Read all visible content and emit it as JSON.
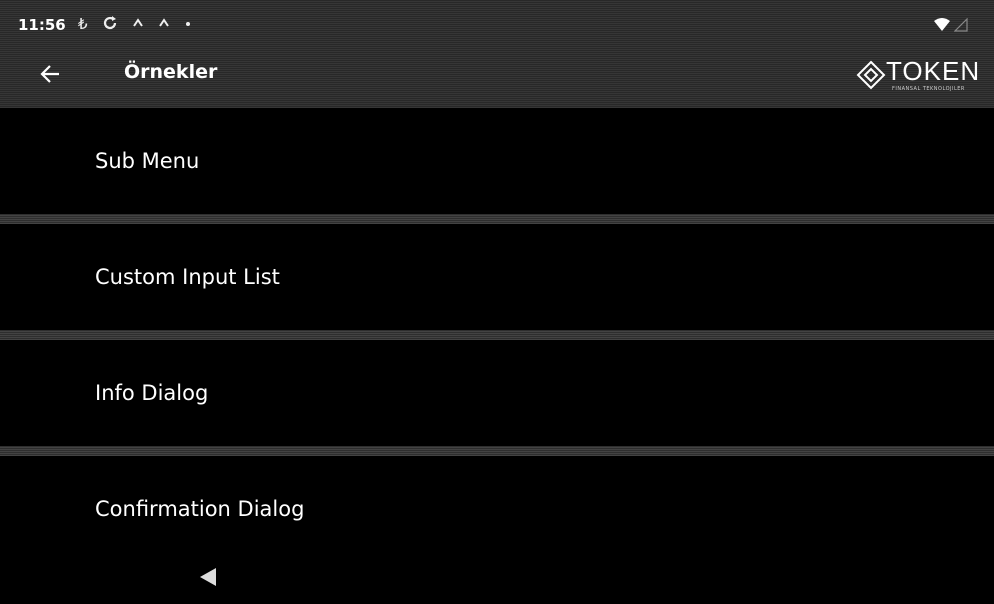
{
  "status_bar": {
    "time": "11:56",
    "icons": [
      "lira-icon",
      "sync-icon",
      "notification-icon",
      "notification-icon",
      "dot-icon"
    ],
    "right_icons": [
      "wifi-icon",
      "signal-icon"
    ]
  },
  "app_bar": {
    "title": "Örnekler",
    "logo_text": "TOKEN",
    "logo_subtitle": "FINANSAL TEKNOLOJILER"
  },
  "menu": {
    "items": [
      {
        "label": "Sub Menu"
      },
      {
        "label": "Custom Input List"
      },
      {
        "label": "Info Dialog"
      },
      {
        "label": "Confirmation Dialog"
      }
    ]
  }
}
